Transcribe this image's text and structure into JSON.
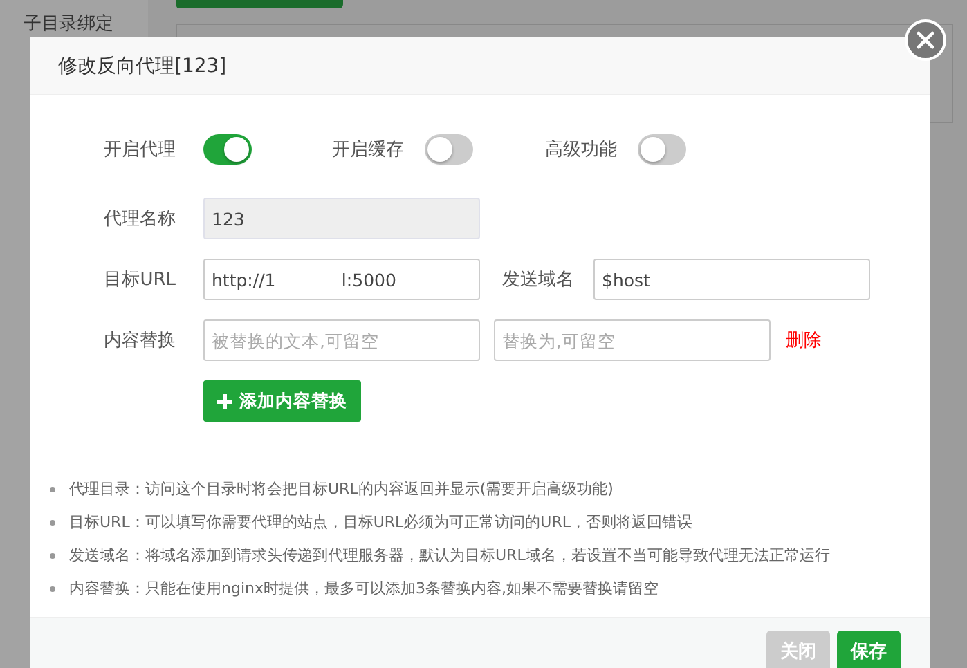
{
  "background": {
    "sidebar_items": [
      "子目录绑定"
    ]
  },
  "dialog": {
    "title": "修改反向代理[123]",
    "toggles": [
      {
        "label": "开启代理",
        "on": true
      },
      {
        "label": "开启缓存",
        "on": false
      },
      {
        "label": "高级功能",
        "on": false
      }
    ],
    "proxy_name": {
      "label": "代理名称",
      "value": "123",
      "disabled": true
    },
    "target_url": {
      "label": "目标URL",
      "value": "http://1            l:5000"
    },
    "send_domain": {
      "label": "发送域名",
      "value": "$host"
    },
    "content_replace": {
      "label": "内容替换",
      "from_placeholder": "被替换的文本,可留空",
      "to_placeholder": "替换为,可留空",
      "delete": "删除"
    },
    "add_button": "添加内容替换",
    "tips": [
      "代理目录：访问这个目录时将会把目标URL的内容返回并显示(需要开启高级功能)",
      "目标URL：可以填写你需要代理的站点，目标URL必须为可正常访问的URL，否则将返回错误",
      "发送域名：将域名添加到请求头传递到代理服务器，默认为目标URL域名，若设置不当可能导致代理无法正常运行",
      "内容替换：只能在使用nginx时提供，最多可以添加3条替换内容,如果不需要替换请留空"
    ],
    "buttons": [
      {
        "label": "关闭",
        "kind": "secondary"
      },
      {
        "label": "保存",
        "kind": "primary"
      }
    ]
  }
}
